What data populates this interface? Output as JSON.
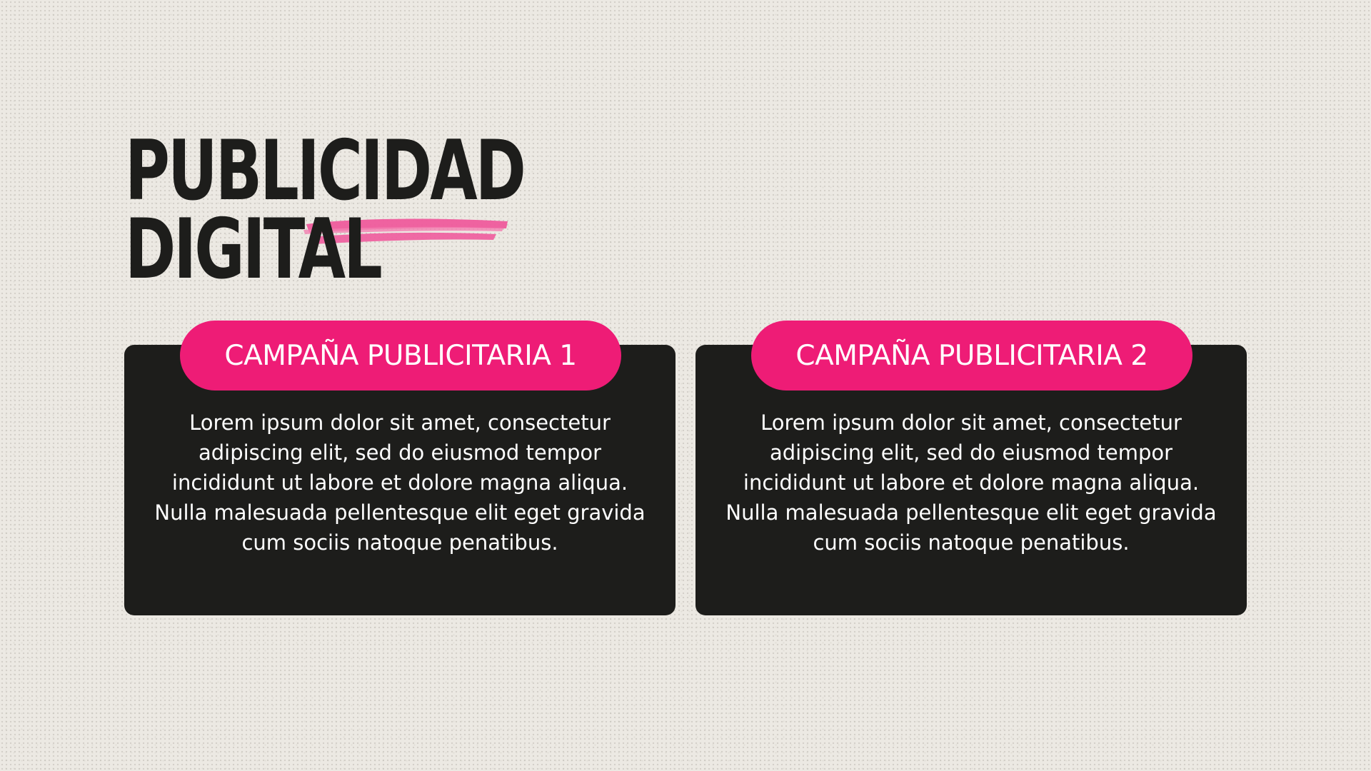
{
  "title": {
    "line1": "PUBLICIDAD",
    "line2": "DIGITAL"
  },
  "colors": {
    "background": "#ece9e3",
    "dark": "#1d1d1b",
    "accent_pink": "#ee1c76",
    "brush_pink": "#ef5b9c",
    "text_light": "#ffffff"
  },
  "cards": [
    {
      "label": "CAMPAÑA PUBLICITARIA 1",
      "body": "Lorem ipsum dolor sit amet, consectetur adipiscing elit, sed do eiusmod tempor incididunt ut labore et dolore magna aliqua. Nulla malesuada pellentesque elit eget gravida cum sociis natoque penatibus."
    },
    {
      "label": "CAMPAÑA PUBLICITARIA 2",
      "body": "Lorem ipsum dolor sit amet, consectetur adipiscing elit, sed do eiusmod tempor incididunt ut labore et dolore magna aliqua. Nulla malesuada pellentesque elit eget gravida cum sociis natoque penatibus."
    }
  ]
}
